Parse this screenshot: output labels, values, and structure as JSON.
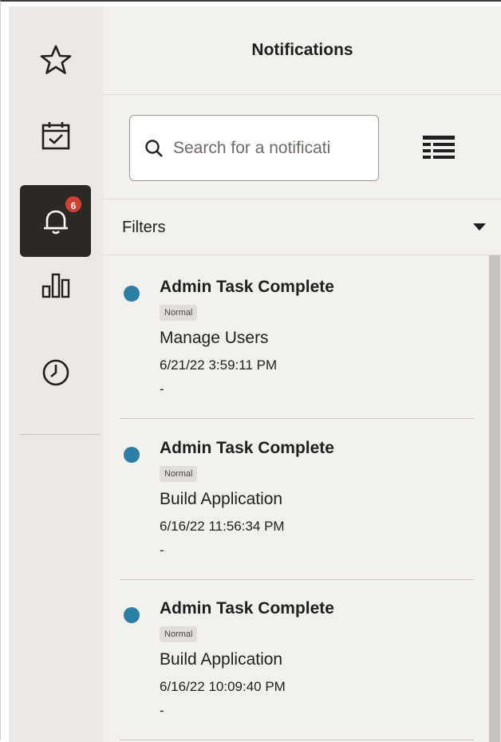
{
  "rail": {
    "items": [
      {
        "name": "favorites",
        "icon": "star-icon"
      },
      {
        "name": "tasks",
        "icon": "calendar-check-icon"
      },
      {
        "name": "notifications",
        "icon": "bell-icon",
        "badge": "6",
        "active": true
      },
      {
        "name": "reports",
        "icon": "bar-chart-icon"
      },
      {
        "name": "recent",
        "icon": "clock-icon"
      }
    ]
  },
  "panel": {
    "title": "Notifications",
    "search": {
      "placeholder": "Search for a notificati",
      "value": ""
    },
    "filters_label": "Filters"
  },
  "notifications": [
    {
      "title": "Admin Task Complete",
      "priority": "Normal",
      "subject": "Manage Users",
      "time": "6/21/22 3:59:11 PM",
      "description": "-"
    },
    {
      "title": "Admin Task Complete",
      "priority": "Normal",
      "subject": "Build Application",
      "time": "6/16/22 11:56:34 PM",
      "description": "-"
    },
    {
      "title": "Admin Task Complete",
      "priority": "Normal",
      "subject": "Build Application",
      "time": "6/16/22 10:09:40 PM",
      "description": "-"
    }
  ],
  "colors": {
    "rail_bg": "#ece8e3",
    "panel_bg": "#f3f1ee",
    "active_bg": "#2b2826",
    "badge": "#d2402f",
    "status_dot": "#2a7fa6"
  }
}
